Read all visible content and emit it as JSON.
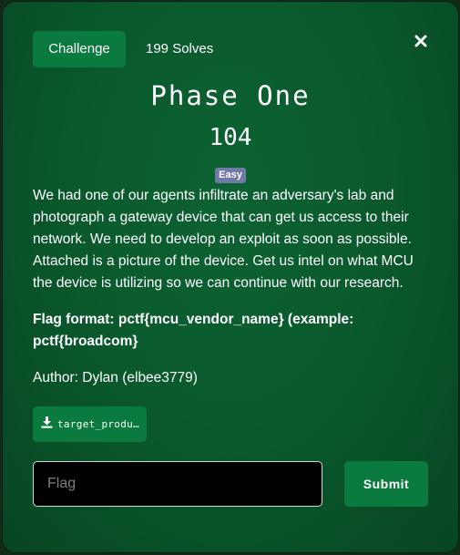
{
  "tabs": {
    "challenge_label": "Challenge",
    "solves_label": "199 Solves"
  },
  "challenge": {
    "name": "Phase One",
    "points": "104",
    "difficulty": "Easy",
    "description": "We had one of our agents infiltrate an adversary's lab and photograph a gateway device that can get us access to their network. We need to develop an exploit as soon as possible. Attached is a picture of the device. Get us intel on what MCU the device is utilizing so we can continue with our research.",
    "flag_format": "Flag format: pctf{mcu_vendor_name} (example: pctf{broadcom}",
    "author": "Author: Dylan (elbee3779)"
  },
  "files": [
    {
      "name": "target_produ...",
      "icon": "download-icon"
    }
  ],
  "form": {
    "flag_placeholder": "Flag",
    "flag_value": "",
    "submit_label": "Submit"
  },
  "icons": {
    "close": "close-icon",
    "download": "download-icon"
  },
  "colors": {
    "modal_bg": "#0a5a2d",
    "accent_green": "#0b7a3f",
    "badge_easy": "#6f7aa8",
    "input_bg": "#000000",
    "text": "#ffffff"
  }
}
